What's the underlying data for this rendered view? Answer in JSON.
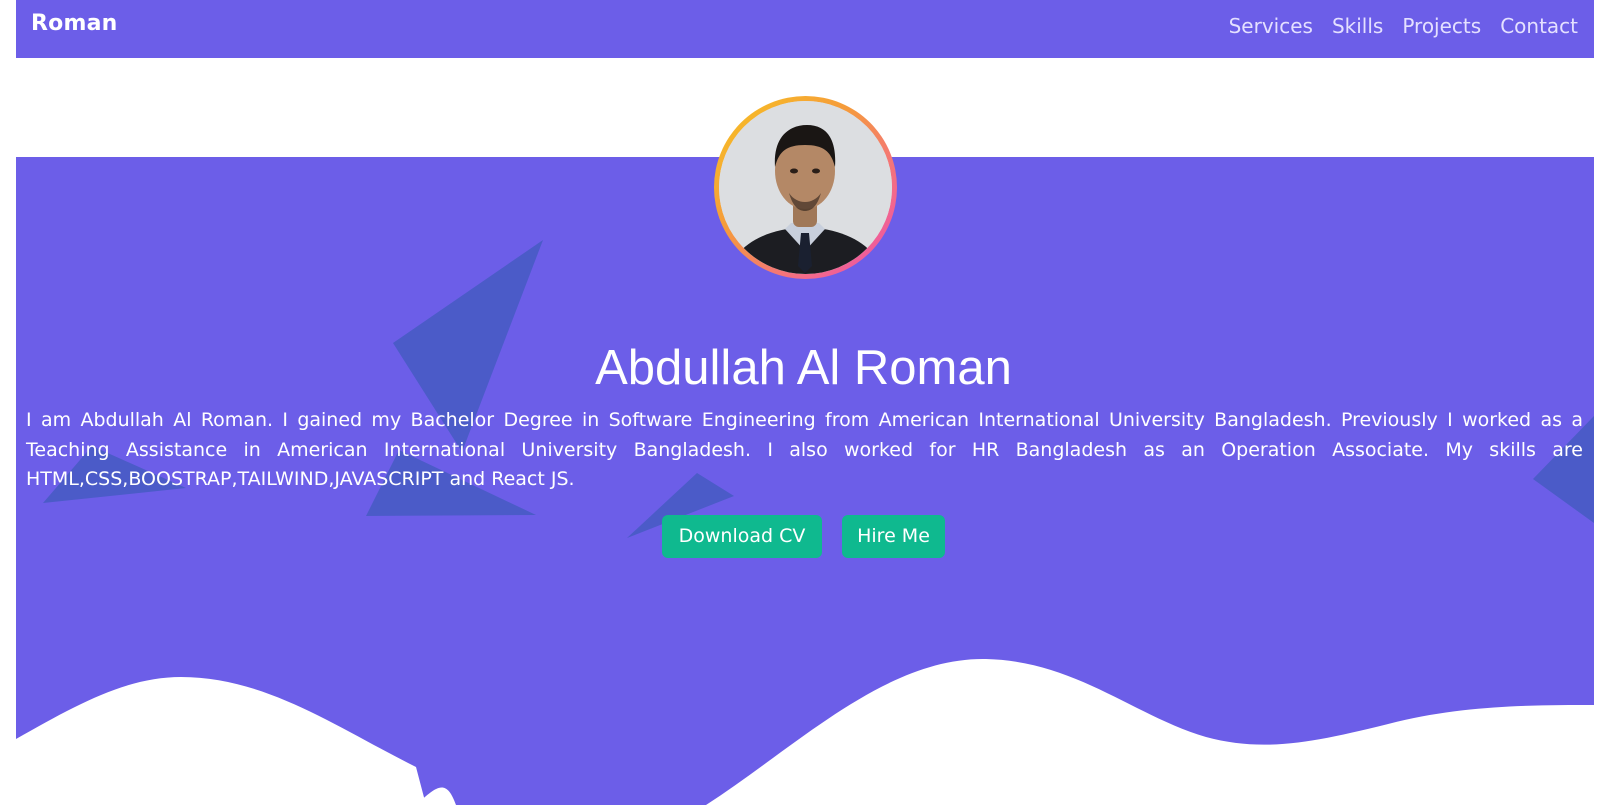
{
  "nav": {
    "brand": "Roman",
    "links": [
      "Services",
      "Skills",
      "Projects",
      "Contact"
    ]
  },
  "hero": {
    "name": "Abdullah Al Roman",
    "bio": "I am Abdullah Al Roman. I gained my Bachelor Degree in Software Engineering from American International University Bangladesh. Previously I worked as a Teaching Assistance in American International University Bangladesh. I also worked for HR Bangladesh as an Operation Associate. My skills are HTML,CSS,BOOSTRAP,TAILWIND,JAVASCRIPT and React JS.",
    "buttons": {
      "download_cv": "Download CV",
      "hire_me": "Hire Me"
    }
  },
  "colors": {
    "primary": "#6c5ee8",
    "accent_button": "#0fb98f",
    "shape": "#4b5bc8",
    "text_light": "#ffffff",
    "nav_link": "#e4e0ff",
    "avatar_ring_start": "#f7c520",
    "avatar_ring_end": "#e94ab0"
  },
  "icons": {
    "avatar": "profile-photo"
  }
}
